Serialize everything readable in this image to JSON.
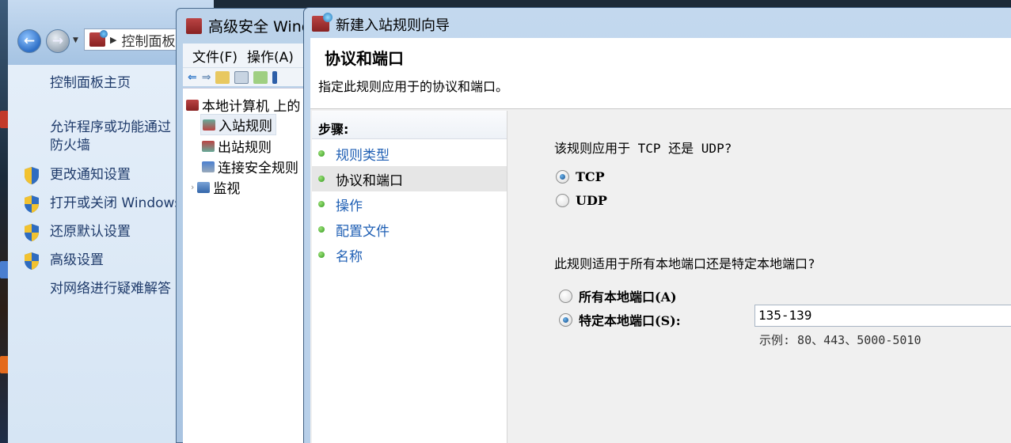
{
  "control_panel": {
    "address_text": "控制面板",
    "links": {
      "home": "控制面板主页",
      "allow_programs": "允许程序或功能通过",
      "allow_programs_line2": "防火墙",
      "change_notifications": "更改通知设置",
      "toggle_firewall": "打开或关闭 Windows",
      "restore_defaults": "还原默认设置",
      "advanced_settings": "高级设置",
      "troubleshoot": "对网络进行疑难解答"
    }
  },
  "advanced_window": {
    "title": "高级安全 Windows",
    "menu": {
      "file": "文件(F)",
      "action": "操作(A)"
    },
    "tree": {
      "root": "本地计算机 上的",
      "inbound": "入站规则",
      "outbound": "出站规则",
      "connection_security": "连接安全规则",
      "monitor": "监视"
    }
  },
  "wizard": {
    "title": "新建入站规则向导",
    "heading": "协议和端口",
    "subheading": "指定此规则应用于的协议和端口。",
    "steps_header": "步骤:",
    "steps": [
      {
        "label": "规则类型",
        "current": false
      },
      {
        "label": "协议和端口",
        "current": true
      },
      {
        "label": "操作",
        "current": false
      },
      {
        "label": "配置文件",
        "current": false
      },
      {
        "label": "名称",
        "current": false
      }
    ],
    "protocol_question": "该规则应用于 TCP 还是 UDP?",
    "protocol_options": {
      "tcp": "TCP",
      "udp": "UDP",
      "selected": "tcp"
    },
    "port_question": "此规则适用于所有本地端口还是特定本地端口?",
    "port_options": {
      "all": "所有本地端口(A)",
      "specific": "特定本地端口(S):",
      "selected": "specific"
    },
    "port_value": "135-139",
    "port_example": "示例: 80、443、5000-5010"
  }
}
